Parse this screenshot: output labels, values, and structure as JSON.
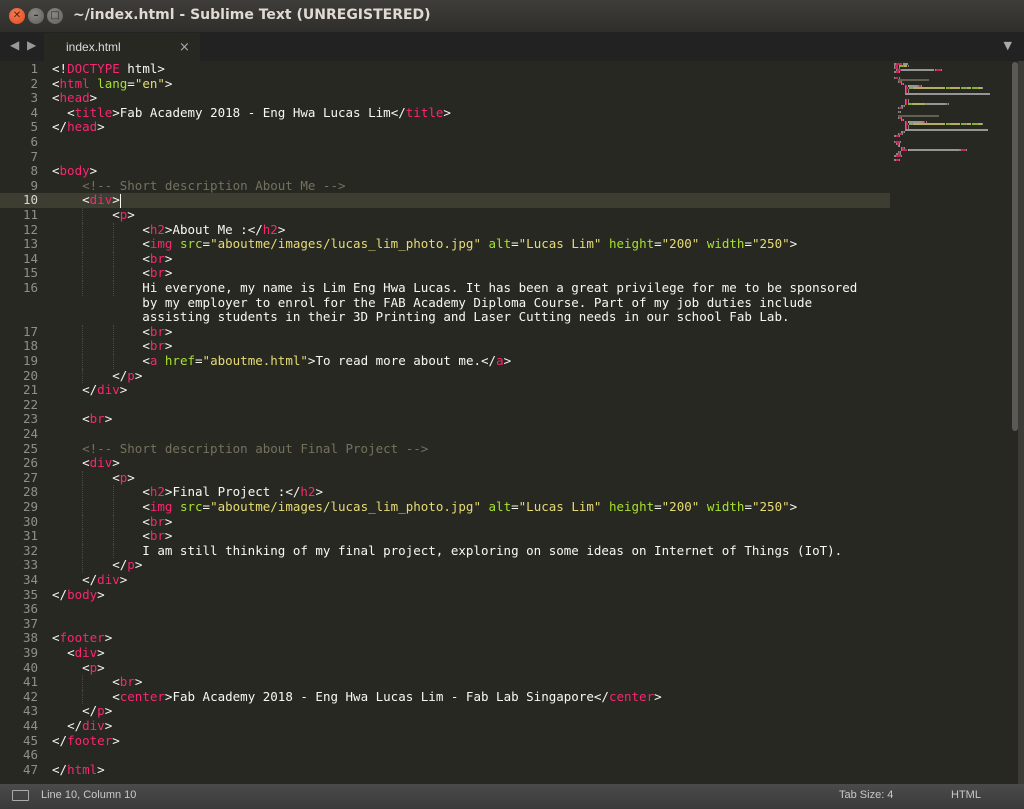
{
  "window": {
    "title": "~/index.html - Sublime Text (UNREGISTERED)",
    "close_glyph": "✕",
    "min_glyph": "–",
    "max_glyph": "□"
  },
  "tabs": [
    {
      "label": "index.html",
      "close_glyph": "×",
      "active": true
    }
  ],
  "editor": {
    "current_line": 10,
    "lines": [
      [
        [
          "pu",
          "<!"
        ],
        [
          "tg",
          "DOCTYPE"
        ],
        [
          "tx",
          " html"
        ],
        [
          "pu",
          ">"
        ]
      ],
      [
        [
          "pu",
          "<"
        ],
        [
          "tg",
          "html"
        ],
        [
          "tx",
          " "
        ],
        [
          "at",
          "lang"
        ],
        [
          "pu",
          "="
        ],
        [
          "st",
          "\"en\""
        ],
        [
          "pu",
          ">"
        ]
      ],
      [
        [
          "pu",
          "<"
        ],
        [
          "tg",
          "head"
        ],
        [
          "pu",
          ">"
        ]
      ],
      [
        [
          "tx",
          "  "
        ],
        [
          "pu",
          "<"
        ],
        [
          "tg",
          "title"
        ],
        [
          "pu",
          ">"
        ],
        [
          "tx",
          "Fab Academy 2018 - Eng Hwa Lucas Lim"
        ],
        [
          "pu",
          "</"
        ],
        [
          "tg",
          "title"
        ],
        [
          "pu",
          ">"
        ]
      ],
      [
        [
          "pu",
          "</"
        ],
        [
          "tg",
          "head"
        ],
        [
          "pu",
          ">"
        ]
      ],
      [],
      [],
      [
        [
          "pu",
          "<"
        ],
        [
          "tg",
          "body"
        ],
        [
          "pu",
          ">"
        ]
      ],
      [
        [
          "tx",
          "    "
        ],
        [
          "cm",
          "<!-- Short description About Me -->"
        ]
      ],
      [
        [
          "tx",
          "    "
        ],
        [
          "pu",
          "<"
        ],
        [
          "tg",
          "div"
        ],
        [
          "pu",
          ">"
        ]
      ],
      [
        [
          "tx",
          "        "
        ],
        [
          "pu",
          "<"
        ],
        [
          "tg",
          "p"
        ],
        [
          "pu",
          ">"
        ]
      ],
      [
        [
          "tx",
          "            "
        ],
        [
          "pu",
          "<"
        ],
        [
          "tg",
          "h2"
        ],
        [
          "pu",
          ">"
        ],
        [
          "tx",
          "About Me :"
        ],
        [
          "pu",
          "</"
        ],
        [
          "tg",
          "h2"
        ],
        [
          "pu",
          ">"
        ]
      ],
      [
        [
          "tx",
          "            "
        ],
        [
          "pu",
          "<"
        ],
        [
          "tg",
          "img"
        ],
        [
          "tx",
          " "
        ],
        [
          "at",
          "src"
        ],
        [
          "pu",
          "="
        ],
        [
          "st",
          "\"aboutme/images/lucas_lim_photo.jpg\""
        ],
        [
          "tx",
          " "
        ],
        [
          "at",
          "alt"
        ],
        [
          "pu",
          "="
        ],
        [
          "st",
          "\"Lucas Lim\""
        ],
        [
          "tx",
          " "
        ],
        [
          "at",
          "height"
        ],
        [
          "pu",
          "="
        ],
        [
          "st",
          "\"200\""
        ],
        [
          "tx",
          " "
        ],
        [
          "at",
          "width"
        ],
        [
          "pu",
          "="
        ],
        [
          "st",
          "\"250\""
        ],
        [
          "pu",
          ">"
        ]
      ],
      [
        [
          "tx",
          "            "
        ],
        [
          "pu",
          "<"
        ],
        [
          "tg",
          "br"
        ],
        [
          "pu",
          ">"
        ]
      ],
      [
        [
          "tx",
          "            "
        ],
        [
          "pu",
          "<"
        ],
        [
          "tg",
          "br"
        ],
        [
          "pu",
          ">"
        ]
      ],
      [
        [
          "tx",
          "            Hi everyone, my name is Lim Eng Hwa Lucas. It has been a great privilege for me to be sponsored"
        ]
      ],
      [
        [
          "tx",
          "            "
        ],
        [
          "pu",
          "<"
        ],
        [
          "tg",
          "br"
        ],
        [
          "pu",
          ">"
        ]
      ],
      [
        [
          "tx",
          "            "
        ],
        [
          "pu",
          "<"
        ],
        [
          "tg",
          "br"
        ],
        [
          "pu",
          ">"
        ]
      ],
      [
        [
          "tx",
          "            "
        ],
        [
          "pu",
          "<"
        ],
        [
          "tg",
          "a"
        ],
        [
          "tx",
          " "
        ],
        [
          "at",
          "href"
        ],
        [
          "pu",
          "="
        ],
        [
          "st",
          "\"aboutme.html\""
        ],
        [
          "pu",
          ">"
        ],
        [
          "tx",
          "To read more about me."
        ],
        [
          "pu",
          "</"
        ],
        [
          "tg",
          "a"
        ],
        [
          "pu",
          ">"
        ]
      ],
      [
        [
          "tx",
          "        "
        ],
        [
          "pu",
          "</"
        ],
        [
          "tg",
          "p"
        ],
        [
          "pu",
          ">"
        ]
      ],
      [
        [
          "tx",
          "    "
        ],
        [
          "pu",
          "</"
        ],
        [
          "tg",
          "div"
        ],
        [
          "pu",
          ">"
        ]
      ],
      [],
      [
        [
          "tx",
          "    "
        ],
        [
          "pu",
          "<"
        ],
        [
          "tg",
          "br"
        ],
        [
          "pu",
          ">"
        ]
      ],
      [],
      [
        [
          "tx",
          "    "
        ],
        [
          "cm",
          "<!-- Short description about Final Project -->"
        ]
      ],
      [
        [
          "tx",
          "    "
        ],
        [
          "pu",
          "<"
        ],
        [
          "tg",
          "div"
        ],
        [
          "pu",
          ">"
        ]
      ],
      [
        [
          "tx",
          "        "
        ],
        [
          "pu",
          "<"
        ],
        [
          "tg",
          "p"
        ],
        [
          "pu",
          ">"
        ]
      ],
      [
        [
          "tx",
          "            "
        ],
        [
          "pu",
          "<"
        ],
        [
          "tg",
          "h2"
        ],
        [
          "pu",
          ">"
        ],
        [
          "tx",
          "Final Project :"
        ],
        [
          "pu",
          "</"
        ],
        [
          "tg",
          "h2"
        ],
        [
          "pu",
          ">"
        ]
      ],
      [
        [
          "tx",
          "            "
        ],
        [
          "pu",
          "<"
        ],
        [
          "tg",
          "img"
        ],
        [
          "tx",
          " "
        ],
        [
          "at",
          "src"
        ],
        [
          "pu",
          "="
        ],
        [
          "st",
          "\"aboutme/images/lucas_lim_photo.jpg\""
        ],
        [
          "tx",
          " "
        ],
        [
          "at",
          "alt"
        ],
        [
          "pu",
          "="
        ],
        [
          "st",
          "\"Lucas Lim\""
        ],
        [
          "tx",
          " "
        ],
        [
          "at",
          "height"
        ],
        [
          "pu",
          "="
        ],
        [
          "st",
          "\"200\""
        ],
        [
          "tx",
          " "
        ],
        [
          "at",
          "width"
        ],
        [
          "pu",
          "="
        ],
        [
          "st",
          "\"250\""
        ],
        [
          "pu",
          ">"
        ]
      ],
      [
        [
          "tx",
          "            "
        ],
        [
          "pu",
          "<"
        ],
        [
          "tg",
          "br"
        ],
        [
          "pu",
          ">"
        ]
      ],
      [
        [
          "tx",
          "            "
        ],
        [
          "pu",
          "<"
        ],
        [
          "tg",
          "br"
        ],
        [
          "pu",
          ">"
        ]
      ],
      [
        [
          "tx",
          "            I am still thinking of my final project, exploring on some ideas on Internet of Things (IoT)."
        ]
      ],
      [
        [
          "tx",
          "        "
        ],
        [
          "pu",
          "</"
        ],
        [
          "tg",
          "p"
        ],
        [
          "pu",
          ">"
        ]
      ],
      [
        [
          "tx",
          "    "
        ],
        [
          "pu",
          "</"
        ],
        [
          "tg",
          "div"
        ],
        [
          "pu",
          ">"
        ]
      ],
      [
        [
          "pu",
          "</"
        ],
        [
          "tg",
          "body"
        ],
        [
          "pu",
          ">"
        ]
      ],
      [],
      [],
      [
        [
          "pu",
          "<"
        ],
        [
          "tg",
          "footer"
        ],
        [
          "pu",
          ">"
        ]
      ],
      [
        [
          "tx",
          "  "
        ],
        [
          "pu",
          "<"
        ],
        [
          "tg",
          "div"
        ],
        [
          "pu",
          ">"
        ]
      ],
      [
        [
          "tx",
          "    "
        ],
        [
          "pu",
          "<"
        ],
        [
          "tg",
          "p"
        ],
        [
          "pu",
          ">"
        ]
      ],
      [
        [
          "tx",
          "        "
        ],
        [
          "pu",
          "<"
        ],
        [
          "tg",
          "br"
        ],
        [
          "pu",
          ">"
        ]
      ],
      [
        [
          "tx",
          "        "
        ],
        [
          "pu",
          "<"
        ],
        [
          "tg",
          "center"
        ],
        [
          "pu",
          ">"
        ],
        [
          "tx",
          "Fab Academy 2018 - Eng Hwa Lucas Lim - Fab Lab Singapore"
        ],
        [
          "pu",
          "</"
        ],
        [
          "tg",
          "center"
        ],
        [
          "pu",
          ">"
        ]
      ],
      [
        [
          "tx",
          "    "
        ],
        [
          "pu",
          "</"
        ],
        [
          "tg",
          "p"
        ],
        [
          "pu",
          ">"
        ]
      ],
      [
        [
          "tx",
          "  "
        ],
        [
          "pu",
          "</"
        ],
        [
          "tg",
          "div"
        ],
        [
          "pu",
          ">"
        ]
      ],
      [
        [
          "pu",
          "</"
        ],
        [
          "tg",
          "footer"
        ],
        [
          "pu",
          ">"
        ]
      ],
      [],
      [
        [
          "pu",
          "</"
        ],
        [
          "tg",
          "html"
        ],
        [
          "pu",
          ">"
        ]
      ]
    ],
    "wrap_lines": {
      "16": [
        "            by my employer to enrol for the FAB Academy Diploma Course. Part of my job duties include",
        "            assisting students in their 3D Printing and Laser Cutting needs in our school Fab Lab."
      ]
    }
  },
  "statusbar": {
    "position": "Line 10, Column 10",
    "tab_size": "Tab Size: 4",
    "syntax": "HTML"
  },
  "theme": {
    "background": "#272822",
    "tag": "#f92672",
    "attribute": "#a6e22e",
    "string": "#e6db74",
    "comment": "#75715e",
    "text": "#f8f8f2"
  },
  "icons": {
    "nav": "left-right-arrows-icon",
    "tab_menu": "chevron-down-icon",
    "status": "panel-toggle-icon"
  }
}
